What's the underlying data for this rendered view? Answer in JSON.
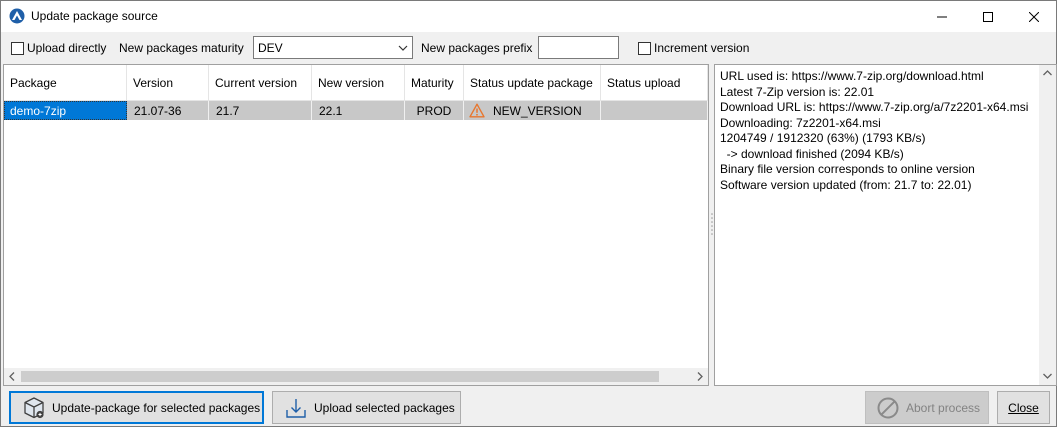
{
  "window": {
    "title": "Update package source"
  },
  "toolbar": {
    "upload_directly_label": "Upload directly",
    "upload_directly_checked": false,
    "maturity_label": "New packages maturity",
    "maturity_value": "DEV",
    "prefix_label": "New packages prefix",
    "prefix_value": "",
    "increment_label": "Increment version",
    "increment_checked": false
  },
  "grid": {
    "columns": [
      "Package",
      "Version",
      "Current version",
      "New version",
      "Maturity",
      "Status update package",
      "Status upload"
    ],
    "rows": [
      {
        "package": "demo-7zip",
        "version": "21.07-36",
        "current_version": "21.7",
        "new_version": "22.1",
        "maturity": "PROD",
        "status_update": "NEW_VERSION",
        "status_upload": ""
      }
    ]
  },
  "log": {
    "lines": [
      "URL used is: https://www.7-zip.org/download.html",
      "Latest 7-Zip version is: 22.01",
      "Download URL is: https://www.7-zip.org/a/7z2201-x64.msi",
      "Downloading: 7z2201-x64.msi",
      "1204749 / 1912320 (63%) (1793 KB/s)",
      "  -> download finished (2094 KB/s)",
      "Binary file version corresponds to online version",
      "Software version updated (from: 21.7 to: 22.01)"
    ]
  },
  "buttons": {
    "update_package": "Update-package for selected packages",
    "upload_selected": "Upload selected packages",
    "abort": "Abort process",
    "close": "Close"
  },
  "colors": {
    "selection": "#0078d7",
    "row_bg": "#c8c8c8",
    "warning": "#e8762d",
    "icon_blue": "#1f5fa8"
  },
  "icons": {
    "app": "wapt-app-icon",
    "warning": "warning-triangle-icon",
    "update": "package-box-icon",
    "upload": "upload-arrow-icon",
    "abort": "prohibited-icon"
  }
}
